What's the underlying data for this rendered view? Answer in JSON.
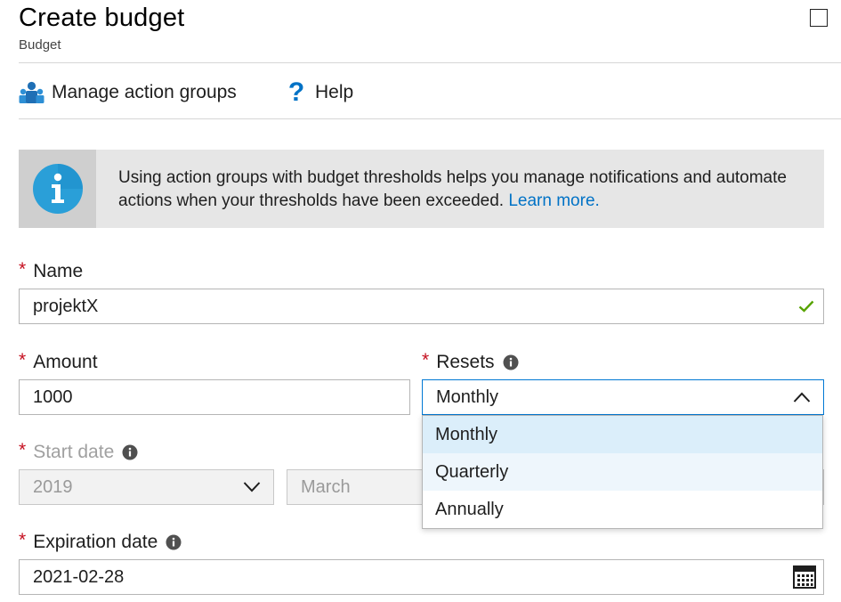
{
  "header": {
    "title": "Create budget",
    "subtitle": "Budget"
  },
  "toolbar": {
    "manage_label": "Manage action groups",
    "help_label": "Help"
  },
  "banner": {
    "text": "Using action groups with budget thresholds helps you manage notifications and automate actions when your thresholds have been exceeded.",
    "link": "Learn more."
  },
  "form": {
    "required_mark": "*",
    "name": {
      "label": "Name",
      "value": "projektX",
      "valid": true
    },
    "amount": {
      "label": "Amount",
      "value": "1000"
    },
    "resets": {
      "label": "Resets",
      "value": "Monthly",
      "expanded": true,
      "options": [
        "Monthly",
        "Quarterly",
        "Annually"
      ],
      "selected_index": 0,
      "hover_index": 1
    },
    "start_date": {
      "label": "Start date",
      "year": "2019",
      "month": "March",
      "disabled": true
    },
    "expiration_date": {
      "label": "Expiration date",
      "value": "2021-02-28"
    }
  },
  "colors": {
    "required": "#c50f1f",
    "accent": "#0072c6",
    "valid_check": "#57a300",
    "banner_bg": "#e6e6e6",
    "info_icon": "#2a9fd8"
  },
  "icons": {
    "maximize": "maximize-icon",
    "manage": "people-icon",
    "help": "question-icon",
    "banner": "info-circle-icon",
    "valid": "checkmark-icon",
    "chevron_up": "chevron-up-icon",
    "chevron_down": "chevron-down-icon",
    "calendar": "calendar-icon",
    "tooltip": "info-icon"
  }
}
